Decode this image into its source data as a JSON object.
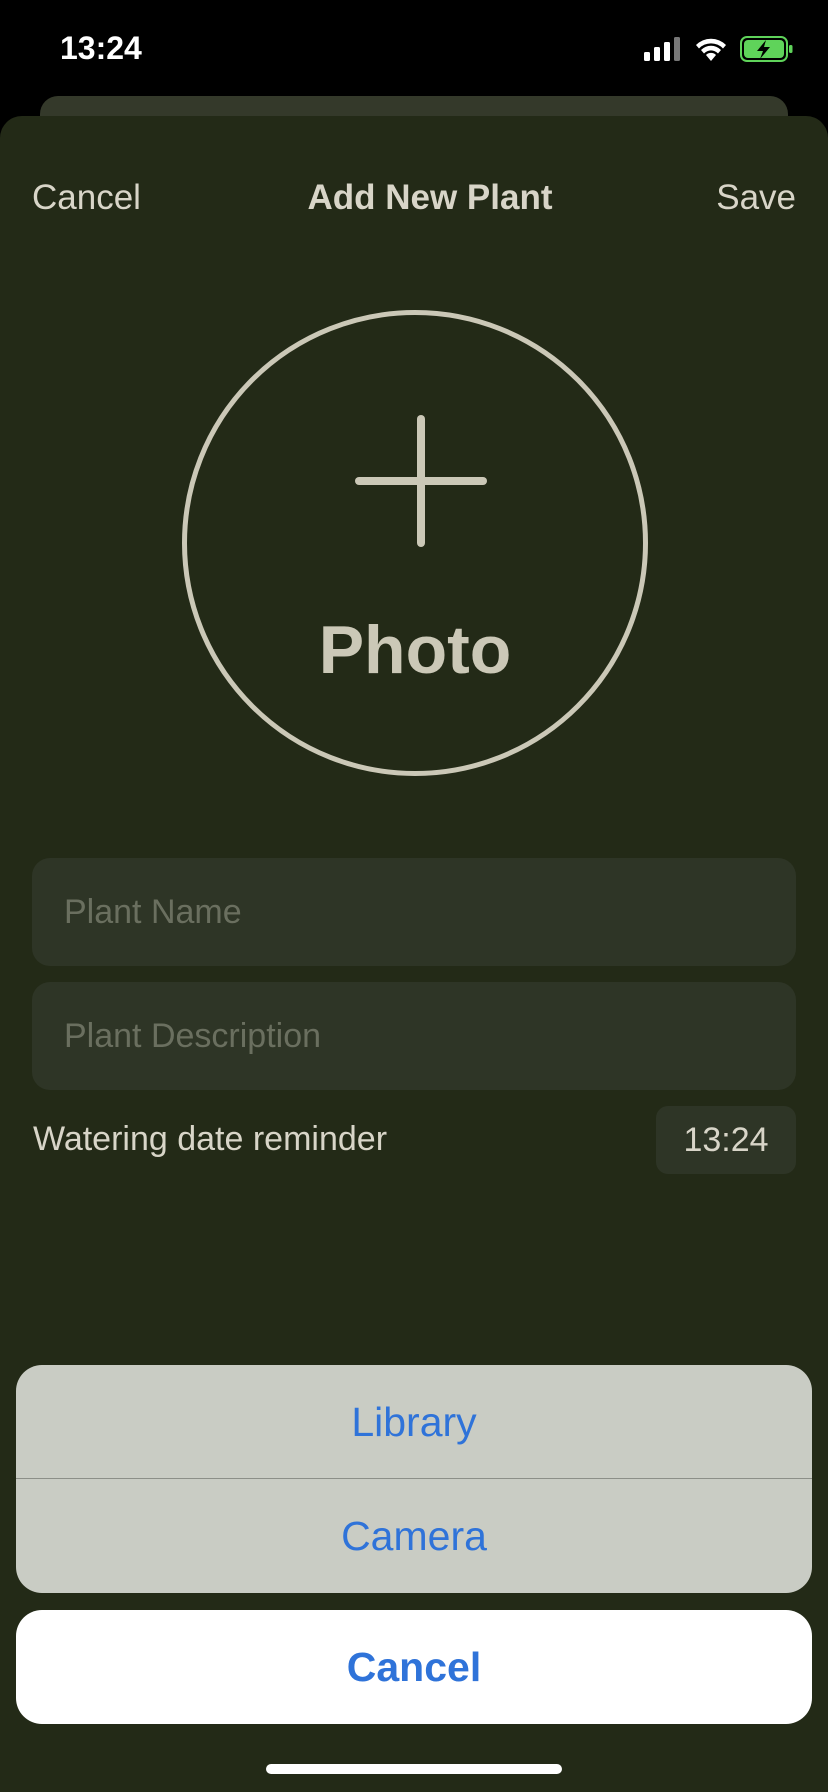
{
  "status_bar": {
    "time": "13:24",
    "icons": [
      "cellular-signal-icon",
      "wifi-icon",
      "battery-charging-icon"
    ]
  },
  "nav": {
    "cancel_label": "Cancel",
    "title": "Add New Plant",
    "save_label": "Save"
  },
  "photo": {
    "label": "Photo",
    "icon": "plus-icon"
  },
  "form": {
    "plant_name": {
      "value": "",
      "placeholder": "Plant Name"
    },
    "plant_description": {
      "value": "",
      "placeholder": "Plant Description"
    },
    "reminder_label": "Watering date reminder",
    "reminder_time": "13:24"
  },
  "action_sheet": {
    "options": [
      {
        "label": "Library"
      },
      {
        "label": "Camera"
      }
    ],
    "cancel_label": "Cancel"
  },
  "colors": {
    "background": "#232a17",
    "accent_text": "#d8d5c8",
    "action_blue": "#2f73d9",
    "battery_green": "#5fd35a"
  }
}
